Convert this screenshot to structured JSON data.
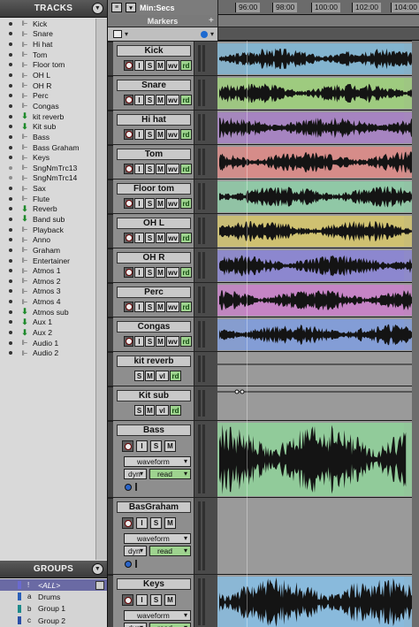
{
  "tracks_panel": {
    "title": "TRACKS",
    "items": [
      {
        "label": "Kick",
        "kind": "audio"
      },
      {
        "label": "Snare",
        "kind": "audio"
      },
      {
        "label": "Hi hat",
        "kind": "audio"
      },
      {
        "label": "Tom",
        "kind": "audio"
      },
      {
        "label": "Floor tom",
        "kind": "audio"
      },
      {
        "label": "OH L",
        "kind": "audio"
      },
      {
        "label": "OH R",
        "kind": "audio"
      },
      {
        "label": "Perc",
        "kind": "audio"
      },
      {
        "label": "Congas",
        "kind": "audio"
      },
      {
        "label": "kit reverb",
        "kind": "aux"
      },
      {
        "label": "Kit sub",
        "kind": "aux"
      },
      {
        "label": "Bass",
        "kind": "audio"
      },
      {
        "label": "Bass Graham",
        "kind": "audio"
      },
      {
        "label": "Keys",
        "kind": "audio"
      },
      {
        "label": "SngNmTrc13",
        "kind": "audio-hidden"
      },
      {
        "label": "SngNmTrc14",
        "kind": "audio-hidden"
      },
      {
        "label": "Sax",
        "kind": "audio"
      },
      {
        "label": "Flute",
        "kind": "audio"
      },
      {
        "label": "Reverb",
        "kind": "aux"
      },
      {
        "label": "Band sub",
        "kind": "aux"
      },
      {
        "label": "Playback",
        "kind": "audio"
      },
      {
        "label": "Anno",
        "kind": "audio"
      },
      {
        "label": "Graham",
        "kind": "audio"
      },
      {
        "label": "Entertainer",
        "kind": "audio"
      },
      {
        "label": "Atmos 1",
        "kind": "audio"
      },
      {
        "label": "Atmos 2",
        "kind": "audio"
      },
      {
        "label": "Atmos 3",
        "kind": "audio"
      },
      {
        "label": "Atmos 4",
        "kind": "audio"
      },
      {
        "label": "Atmos sub",
        "kind": "aux"
      },
      {
        "label": "Aux 1",
        "kind": "aux"
      },
      {
        "label": "Aux 2",
        "kind": "aux"
      },
      {
        "label": "Audio 1",
        "kind": "audio"
      },
      {
        "label": "Audio 2",
        "kind": "audio"
      }
    ]
  },
  "groups_panel": {
    "title": "GROUPS",
    "items": [
      {
        "id": "!",
        "label": "<ALL>",
        "color": "#6a6ad0",
        "selected": true
      },
      {
        "id": "a",
        "label": "Drums",
        "color": "#2a5fb8",
        "selected": false
      },
      {
        "id": "b",
        "label": "Group 1",
        "color": "#1d8a8a",
        "selected": false
      },
      {
        "id": "c",
        "label": "Group 2",
        "color": "#2a4fa8",
        "selected": false
      }
    ]
  },
  "header": {
    "timebase": "Min:Secs",
    "markers_label": "Markers",
    "markers_add": "+",
    "ruler_ticks": [
      "96:00",
      "98:00",
      "100:00",
      "102:00",
      "104:00"
    ]
  },
  "edit_tracks": [
    {
      "name": "Kick",
      "color": "#7fb8d8",
      "type": "audio",
      "buttons": [
        "I",
        "S",
        "M"
      ],
      "view": "wv",
      "auto": "rd"
    },
    {
      "name": "Snare",
      "color": "#9fd47a",
      "type": "audio",
      "buttons": [
        "I",
        "S",
        "M"
      ],
      "view": "wv",
      "auto": "rd"
    },
    {
      "name": "Hi hat",
      "color": "#a880c8",
      "type": "audio",
      "buttons": [
        "I",
        "S",
        "M"
      ],
      "view": "wv",
      "auto": "rd"
    },
    {
      "name": "Tom",
      "color": "#e08a86",
      "type": "audio",
      "buttons": [
        "I",
        "S",
        "M"
      ],
      "view": "wv",
      "auto": "rd"
    },
    {
      "name": "Floor tom",
      "color": "#8ed0a8",
      "type": "audio",
      "buttons": [
        "I",
        "S",
        "M"
      ],
      "view": "wv",
      "auto": "rd"
    },
    {
      "name": "OH L",
      "color": "#d8c86a",
      "type": "audio",
      "buttons": [
        "I",
        "S",
        "M"
      ],
      "view": "wv",
      "auto": "rd"
    },
    {
      "name": "OH R",
      "color": "#8a84d8",
      "type": "audio",
      "buttons": [
        "I",
        "S",
        "M"
      ],
      "view": "wv",
      "auto": "rd"
    },
    {
      "name": "Perc",
      "color": "#cc80cc",
      "type": "audio",
      "buttons": [
        "I",
        "S",
        "M"
      ],
      "view": "wv",
      "auto": "rd"
    },
    {
      "name": "Congas",
      "color": "#7f9ee0",
      "type": "audio",
      "buttons": [
        "I",
        "S",
        "M"
      ],
      "view": "wv",
      "auto": "rd"
    },
    {
      "name": "kit reverb",
      "color": "",
      "type": "aux",
      "buttons": [
        "S",
        "M"
      ],
      "view": "vl",
      "auto": "rd"
    },
    {
      "name": "Kit sub",
      "color": "",
      "type": "aux",
      "buttons": [
        "S",
        "M"
      ],
      "view": "vl",
      "auto": "rd"
    },
    {
      "name": "Bass",
      "color": "#8fd49a",
      "type": "audio-large",
      "buttons": [
        "I",
        "S",
        "M"
      ],
      "view_dd": "waveform",
      "auto_label": "dyn",
      "auto_dd": "read"
    },
    {
      "name": "BasGraham",
      "color": "",
      "type": "audio-large",
      "buttons": [
        "I",
        "S",
        "M"
      ],
      "view_dd": "waveform",
      "auto_label": "dyn",
      "auto_dd": "read"
    },
    {
      "name": "Keys",
      "color": "#86c0e8",
      "type": "audio-large",
      "buttons": [
        "I",
        "S",
        "M"
      ],
      "view_dd": "waveform",
      "auto_label": "dyn",
      "auto_dd": "read"
    }
  ]
}
